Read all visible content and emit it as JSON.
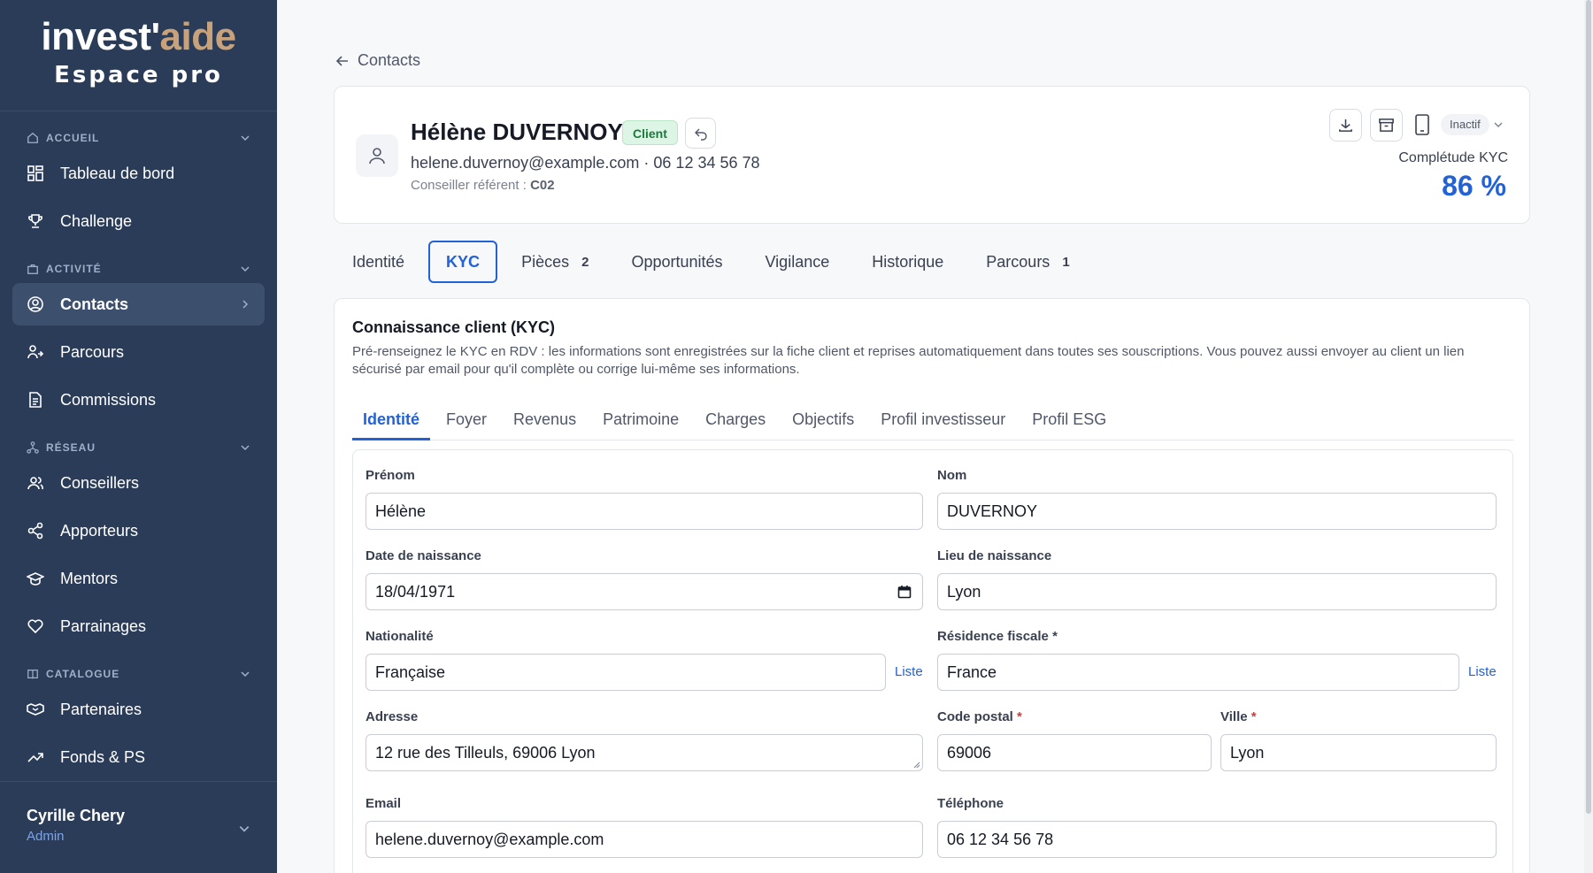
{
  "brand": {
    "logo_main": "invest'",
    "logo_accent": "aide",
    "logo_sub": "Espace pro"
  },
  "sidebar": {
    "sections": [
      {
        "label": "ACCUEIL",
        "items": [
          {
            "label": "Tableau de bord",
            "icon": "dashboard-icon"
          },
          {
            "label": "Challenge",
            "icon": "trophy-icon"
          }
        ]
      },
      {
        "label": "ACTIVITÉ",
        "items": [
          {
            "label": "Contacts",
            "icon": "contact-icon",
            "active": true
          },
          {
            "label": "Parcours",
            "icon": "route-icon"
          },
          {
            "label": "Commissions",
            "icon": "document-icon"
          }
        ]
      },
      {
        "label": "RÉSEAU",
        "items": [
          {
            "label": "Conseillers",
            "icon": "users-icon"
          },
          {
            "label": "Apporteurs",
            "icon": "share-icon"
          },
          {
            "label": "Mentors",
            "icon": "graduation-icon"
          },
          {
            "label": "Parrainages",
            "icon": "heart-icon"
          }
        ]
      },
      {
        "label": "CATALOGUE",
        "items": [
          {
            "label": "Partenaires",
            "icon": "handshake-icon"
          },
          {
            "label": "Fonds & PS",
            "icon": "trend-icon"
          }
        ]
      }
    ],
    "user": {
      "name": "Cyrille Chery",
      "role": "Admin"
    }
  },
  "breadcrumb": {
    "back_label": "Contacts"
  },
  "client": {
    "name": "Hélène DUVERNOY",
    "badge": "Client",
    "contact_line": "helene.duvernoy@example.com · 06 12 34 56 78",
    "advisor_label": "Conseiller référent : ",
    "advisor_code": "C02",
    "status": "Inactif",
    "kyc_label": "Complétude KYC",
    "kyc_value": "86 %"
  },
  "tabs": [
    {
      "label": "Identité",
      "count": ""
    },
    {
      "label": "KYC",
      "count": "",
      "active": true
    },
    {
      "label": "Pièces",
      "count": "2"
    },
    {
      "label": "Opportunités",
      "count": ""
    },
    {
      "label": "Vigilance",
      "count": ""
    },
    {
      "label": "Historique",
      "count": ""
    },
    {
      "label": "Parcours",
      "count": "1"
    }
  ],
  "kyc": {
    "title": "Connaissance client (KYC)",
    "description": "Pré-renseignez le KYC en RDV : les informations sont enregistrées sur la fiche client et reprises automatiquement dans toutes ses souscriptions. Vous pouvez aussi envoyer au client un lien sécurisé par email pour qu'il complète ou corrige lui-même ses informations.",
    "subtabs": [
      "Identité",
      "Foyer",
      "Revenus",
      "Patrimoine",
      "Charges",
      "Objectifs",
      "Profil investisseur",
      "Profil ESG"
    ],
    "active_subtab": "Identité"
  },
  "form": {
    "prenom": {
      "label": "Prénom",
      "value": "Hélène"
    },
    "nom": {
      "label": "Nom",
      "value": "DUVERNOY"
    },
    "date_naissance": {
      "label": "Date de naissance",
      "value": "18/04/1971"
    },
    "lieu_naissance": {
      "label": "Lieu de naissance",
      "value": "Lyon"
    },
    "nationalite": {
      "label": "Nationalité",
      "value": "Française",
      "link": "Liste"
    },
    "residence": {
      "label": "Résidence fiscale *",
      "value": "France",
      "link": "Liste"
    },
    "adresse": {
      "label": "Adresse",
      "value": "12 rue des Tilleuls, 69006 Lyon"
    },
    "code_postal": {
      "label": "Code postal",
      "req": "*",
      "value": "69006"
    },
    "ville": {
      "label": "Ville",
      "req": "*",
      "value": "Lyon"
    },
    "email": {
      "label": "Email",
      "value": "helene.duvernoy@example.com"
    },
    "telephone": {
      "label": "Téléphone",
      "value": "06 12 34 56 78"
    }
  },
  "colors": {
    "sidebar_bg": "#2a3c58",
    "accent": "#2361d6",
    "logo_accent": "#c8a27a",
    "badge_bg": "#dcf5e4"
  }
}
